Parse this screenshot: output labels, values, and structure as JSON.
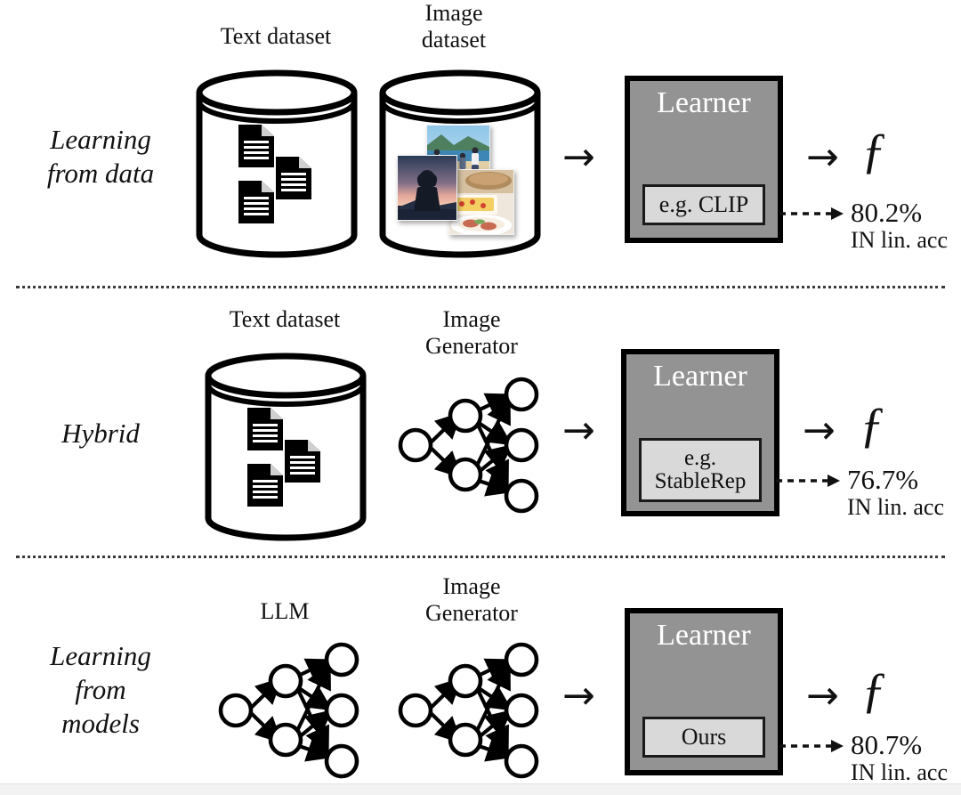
{
  "figure": {
    "kind": "three-row comparison diagram",
    "accent_gray": "#939393",
    "chip_gray": "#d9d9d9",
    "ink": "#111111",
    "divider_color": "#3a3a3a"
  },
  "columns": {
    "row1": {
      "source_caption": "Text dataset",
      "generator_caption": "Image\ndataset",
      "generator_caption_line1": "Image",
      "generator_caption_line2": "dataset"
    },
    "row2": {
      "source_caption": "Text dataset",
      "generator_caption_line1": "Image",
      "generator_caption_line2": "Generator"
    },
    "row3": {
      "source_caption": "LLM",
      "generator_caption_line1": "Image",
      "generator_caption_line2": "Generator"
    }
  },
  "rows": [
    {
      "id": "learning-from-data",
      "label_line1": "Learning",
      "label_line2": "from data",
      "label_line3": "",
      "learner_title": "Learner",
      "chip_line1": "e.g. CLIP",
      "chip_line2": "",
      "output_symbol": "ƒ",
      "accuracy": "80.2%",
      "accuracy_caption": "IN lin. acc",
      "in_arrow": "→",
      "out_arrow": "→"
    },
    {
      "id": "hybrid",
      "label_line1": "Hybrid",
      "label_line2": "",
      "label_line3": "",
      "learner_title": "Learner",
      "chip_line1": "e.g.",
      "chip_line2": "StableRep",
      "output_symbol": "ƒ",
      "accuracy": "76.7%",
      "accuracy_caption": "IN lin. acc",
      "in_arrow": "→",
      "out_arrow": "→"
    },
    {
      "id": "learning-from-models",
      "label_line1": "Learning",
      "label_line2": "from",
      "label_line3": "models",
      "learner_title": "Learner",
      "chip_line1": "Ours",
      "chip_line2": "",
      "output_symbol": "ƒ",
      "accuracy": "80.7%",
      "accuracy_caption": "IN lin. acc",
      "in_arrow": "→",
      "out_arrow": "→"
    }
  ],
  "image_thumbnails": [
    {
      "name": "beach-family-photo"
    },
    {
      "name": "sunset-silhouette-photo"
    },
    {
      "name": "food-plate-photo"
    }
  ],
  "neural_net": {
    "input_nodes": 1,
    "hidden_nodes": 2,
    "output_nodes": 3
  },
  "text_docs": {
    "count": 3
  }
}
